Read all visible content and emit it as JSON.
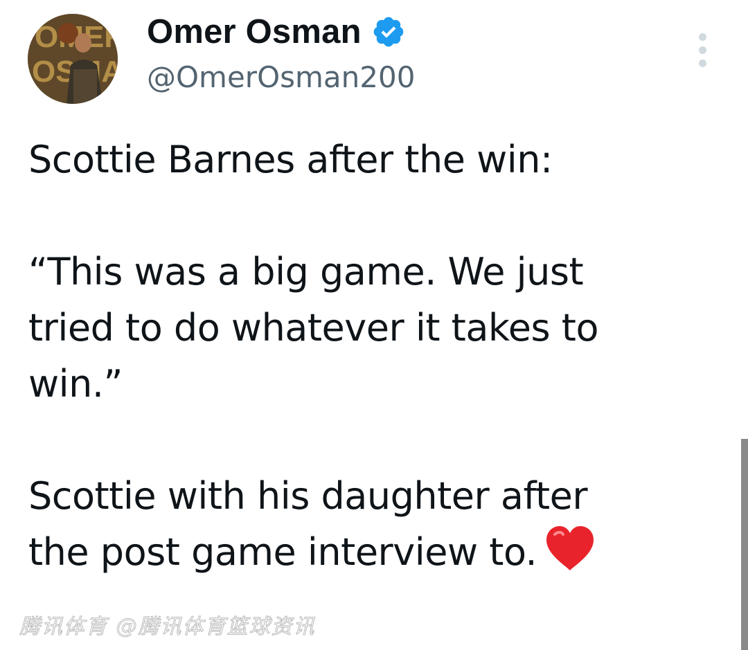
{
  "header": {
    "display_name": "Omer Osman",
    "handle": "@OmerOsman200",
    "verified_color": "#1d9bf0"
  },
  "tweet": {
    "paragraphs": [
      "Scottie Barnes after the win:",
      "“This was a big game. We just\ntried to do whatever it takes to\nwin.”",
      "Scottie with his daughter after\nthe post game interview to."
    ],
    "emoji": "red-heart"
  },
  "watermark": "腾讯体育 @腾讯体育篮球资讯",
  "icons": [
    "verified-badge-icon",
    "more-dots-icon",
    "heart-icon"
  ]
}
